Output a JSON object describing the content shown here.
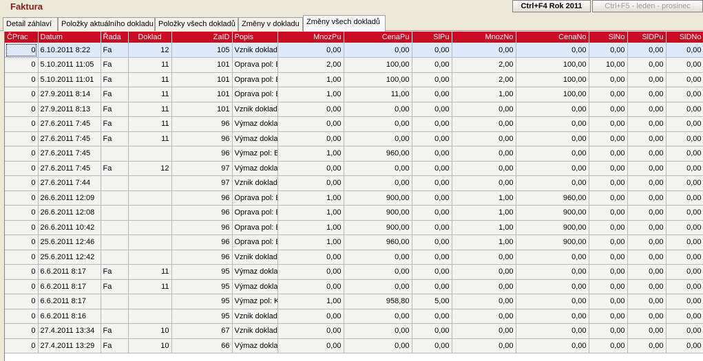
{
  "app": {
    "title": "Faktura"
  },
  "toolbar": {
    "rok_label": "Ctrl+F4 Rok 2011",
    "months_label": "Ctrl+F5 - leden - prosinec"
  },
  "tabs": [
    {
      "label": "Detail záhlaví"
    },
    {
      "label": "Položky aktuálního dokladu"
    },
    {
      "label": "Položky všech dokladů"
    },
    {
      "label": "Změny v dokladu"
    },
    {
      "label": "Změny všech dokladů",
      "active": true
    }
  ],
  "grid": {
    "header_color": "#cc0a20",
    "columns": [
      "ČPrac",
      "Datum",
      "Řada",
      "Doklad",
      "ZaID",
      "Popis",
      "MnozPu",
      "CenaPu",
      "SlPu",
      "MnozNo",
      "CenaNo",
      "SlNo",
      "SlDPu",
      "SlDNo"
    ],
    "rows": [
      [
        "0",
        "6.10.2011 8:22",
        "Fa",
        "12",
        "105",
        "Vznik doklad",
        "0,00",
        "0,00",
        "0,00",
        "0,00",
        "0,00",
        "0,00",
        "0,00",
        "0,00"
      ],
      [
        "0",
        "5.10.2011 11:05",
        "Fa",
        "11",
        "101",
        "Oprava pol: B",
        "2,00",
        "100,00",
        "0,00",
        "2,00",
        "100,00",
        "10,00",
        "0,00",
        "0,00"
      ],
      [
        "0",
        "5.10.2011 11:01",
        "Fa",
        "11",
        "101",
        "Oprava pol: B",
        "1,00",
        "100,00",
        "0,00",
        "2,00",
        "100,00",
        "0,00",
        "0,00",
        "0,00"
      ],
      [
        "0",
        "27.9.2011 8:14",
        "Fa",
        "11",
        "101",
        "Oprava pol: B",
        "1,00",
        "11,00",
        "0,00",
        "1,00",
        "100,00",
        "0,00",
        "0,00",
        "0,00"
      ],
      [
        "0",
        "27.9.2011 8:13",
        "Fa",
        "11",
        "101",
        "Vznik doklad",
        "0,00",
        "0,00",
        "0,00",
        "0,00",
        "0,00",
        "0,00",
        "0,00",
        "0,00"
      ],
      [
        "0",
        "27.6.2011 7:45",
        "Fa",
        "11",
        "96",
        "Výmaz doklad",
        "0,00",
        "0,00",
        "0,00",
        "0,00",
        "0,00",
        "0,00",
        "0,00",
        "0,00"
      ],
      [
        "0",
        "27.6.2011 7:45",
        "Fa",
        "11",
        "96",
        "Výmaz doklad",
        "0,00",
        "0,00",
        "0,00",
        "0,00",
        "0,00",
        "0,00",
        "0,00",
        "0,00"
      ],
      [
        "0",
        "27.6.2011 7:45",
        "",
        "",
        "96",
        "Výmaz pol: B",
        "1,00",
        "960,00",
        "0,00",
        "0,00",
        "0,00",
        "0,00",
        "0,00",
        "0,00"
      ],
      [
        "0",
        "27.6.2011 7:45",
        "Fa",
        "12",
        "97",
        "Výmaz doklad",
        "0,00",
        "0,00",
        "0,00",
        "0,00",
        "0,00",
        "0,00",
        "0,00",
        "0,00"
      ],
      [
        "0",
        "27.6.2011 7:44",
        "",
        "",
        "97",
        "Vznik doklad",
        "0,00",
        "0,00",
        "0,00",
        "0,00",
        "0,00",
        "0,00",
        "0,00",
        "0,00"
      ],
      [
        "0",
        "26.6.2011 12:09",
        "",
        "",
        "96",
        "Oprava pol: B",
        "1,00",
        "900,00",
        "0,00",
        "1,00",
        "960,00",
        "0,00",
        "0,00",
        "0,00"
      ],
      [
        "0",
        "26.6.2011 12:08",
        "",
        "",
        "96",
        "Oprava pol: B",
        "1,00",
        "900,00",
        "0,00",
        "1,00",
        "900,00",
        "0,00",
        "0,00",
        "0,00"
      ],
      [
        "0",
        "26.6.2011 10:42",
        "",
        "",
        "96",
        "Oprava pol: B",
        "1,00",
        "900,00",
        "0,00",
        "1,00",
        "900,00",
        "0,00",
        "0,00",
        "0,00"
      ],
      [
        "0",
        "25.6.2011 12:46",
        "",
        "",
        "96",
        "Oprava pol: B",
        "1,00",
        "960,00",
        "0,00",
        "1,00",
        "900,00",
        "0,00",
        "0,00",
        "0,00"
      ],
      [
        "0",
        "25.6.2011 12:42",
        "",
        "",
        "96",
        "Vznik doklad",
        "0,00",
        "0,00",
        "0,00",
        "0,00",
        "0,00",
        "0,00",
        "0,00",
        "0,00"
      ],
      [
        "0",
        "6.6.2011 8:17",
        "Fa",
        "11",
        "95",
        "Výmaz doklad",
        "0,00",
        "0,00",
        "0,00",
        "0,00",
        "0,00",
        "0,00",
        "0,00",
        "0,00"
      ],
      [
        "0",
        "6.6.2011 8:17",
        "Fa",
        "11",
        "95",
        "Výmaz doklad",
        "0,00",
        "0,00",
        "0,00",
        "0,00",
        "0,00",
        "0,00",
        "0,00",
        "0,00"
      ],
      [
        "0",
        "6.6.2011 8:17",
        "",
        "",
        "95",
        "Výmaz pol: K",
        "1,00",
        "958,80",
        "5,00",
        "0,00",
        "0,00",
        "0,00",
        "0,00",
        "0,00"
      ],
      [
        "0",
        "6.6.2011 8:16",
        "",
        "",
        "95",
        "Vznik doklad",
        "0,00",
        "0,00",
        "0,00",
        "0,00",
        "0,00",
        "0,00",
        "0,00",
        "0,00"
      ],
      [
        "0",
        "27.4.2011 13:34",
        "Fa",
        "10",
        "67",
        "Vznik doklad",
        "0,00",
        "0,00",
        "0,00",
        "0,00",
        "0,00",
        "0,00",
        "0,00",
        "0,00"
      ],
      [
        "0",
        "27.4.2011 13:29",
        "Fa",
        "10",
        "66",
        "Výmaz doklad",
        "0,00",
        "0,00",
        "0,00",
        "0,00",
        "0,00",
        "0,00",
        "0,00",
        "0,00"
      ]
    ]
  }
}
